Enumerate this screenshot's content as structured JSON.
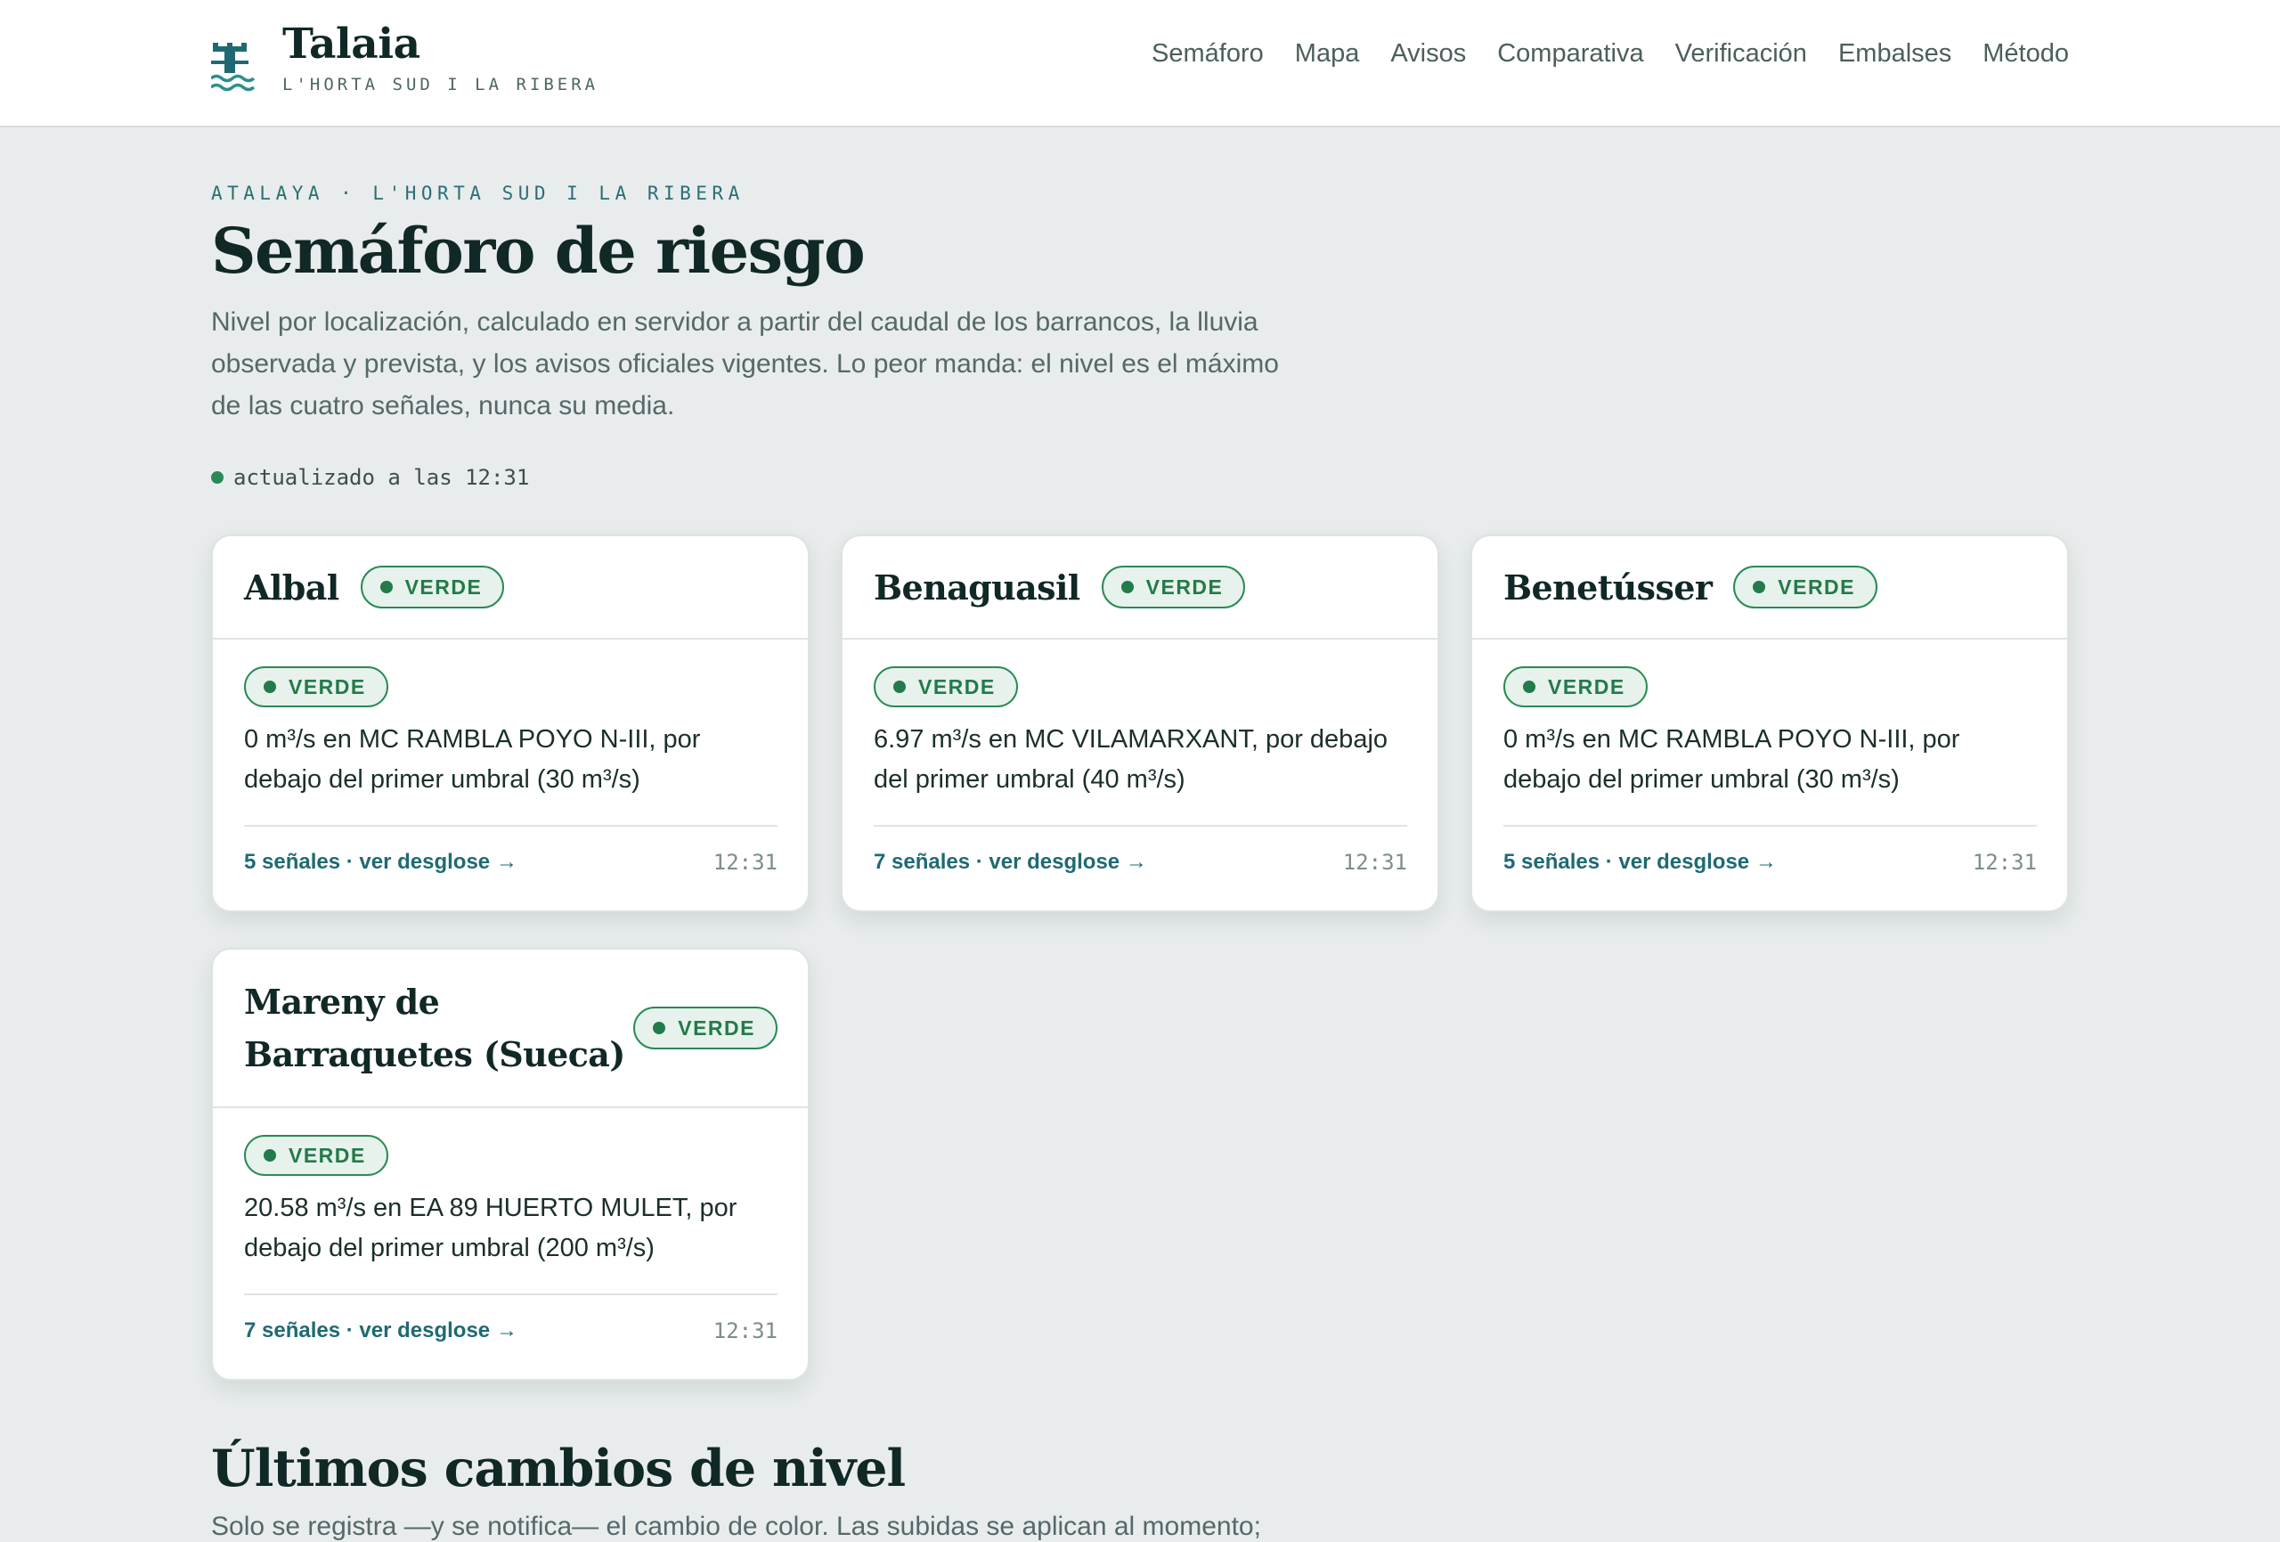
{
  "header": {
    "brand_name": "Talaia",
    "brand_tagline": "L'HORTA SUD I LA RIBERA",
    "nav": [
      "Semáforo",
      "Mapa",
      "Avisos",
      "Comparativa",
      "Verificación",
      "Embalses",
      "Método"
    ]
  },
  "intro": {
    "eyebrow": "ATALAYA · L'HORTA SUD I LA RIBERA",
    "title": "Semáforo de riesgo",
    "lede": "Nivel por localización, calculado en servidor a partir del caudal de los barrancos, la lluvia observada y prevista, y los avisos oficiales vigentes. Lo peor manda: el nivel es el máximo de las cuatro señales, nunca su media.",
    "updated": "actualizado a las 12:31"
  },
  "colors": {
    "verde": "#2a8a55",
    "link": "#1f6a72",
    "background": "#e8ecec"
  },
  "cards": [
    {
      "name": "Albal",
      "level": "VERDE",
      "signal_level": "VERDE",
      "signal_text": "0 m³/s en MC RAMBLA POYO N-III, por debajo del primer umbral (30 m³/s)",
      "breakdown": "5 señales · ver desglose →",
      "time": "12:31"
    },
    {
      "name": "Benaguasil",
      "level": "VERDE",
      "signal_level": "VERDE",
      "signal_text": "6.97 m³/s en MC VILAMARXANT, por debajo del primer umbral (40 m³/s)",
      "breakdown": "7 señales · ver desglose →",
      "time": "12:31"
    },
    {
      "name": "Benetússer",
      "level": "VERDE",
      "signal_level": "VERDE",
      "signal_text": "0 m³/s en MC RAMBLA POYO N-III, por debajo del primer umbral (30 m³/s)",
      "breakdown": "5 señales · ver desglose →",
      "time": "12:31"
    },
    {
      "name": "Mareny de Barraquetes (Sueca)",
      "level": "VERDE",
      "signal_level": "VERDE",
      "signal_text": "20.58 m³/s en EA 89 HUERTO MULET, por debajo del primer umbral (200 m³/s)",
      "breakdown": "7 señales · ver desglose →",
      "time": "12:31"
    }
  ],
  "changes": {
    "title": "Últimos cambios de nivel",
    "lede": "Solo se registra —y se notifica— el cambio de color. Las subidas se aplican al momento;"
  }
}
